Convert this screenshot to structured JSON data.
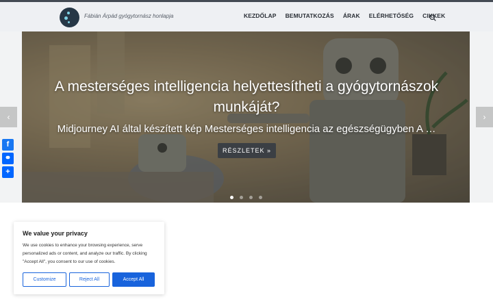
{
  "site": {
    "tagline": "Fábián Árpád gyógytornász honlapja"
  },
  "nav": {
    "items": [
      "KEZDŐLAP",
      "BEMUTATKOZÁS",
      "ÁRAK",
      "ELÉRHETŐSÉG",
      "CIKKEK"
    ]
  },
  "hero": {
    "title": "A mesterséges intelligencia helyettesítheti a gyógytornászok munkáját?",
    "subtitle": "Midjourney AI által készített kép Mesterséges intelligencia az egészségügyben A …",
    "button_label": "RÉSZLETEK »",
    "prev_arrow": "‹",
    "next_arrow": "›",
    "slide_count": 4,
    "active_slide": 1
  },
  "share": {
    "facebook": "f",
    "copy_link": "⚭",
    "add": "+"
  },
  "cookie": {
    "title": "We value your privacy",
    "text": "We use cookies to enhance your browsing experience, serve personalized ads or content, and analyze our traffic. By clicking \"Accept All\", you consent to our use of cookies.",
    "customize_label": "Customize",
    "reject_label": "Reject All",
    "accept_label": "Accept All"
  },
  "colors": {
    "accent": "#1863dc",
    "facebook": "#1877f2",
    "share": "#0166ff"
  }
}
